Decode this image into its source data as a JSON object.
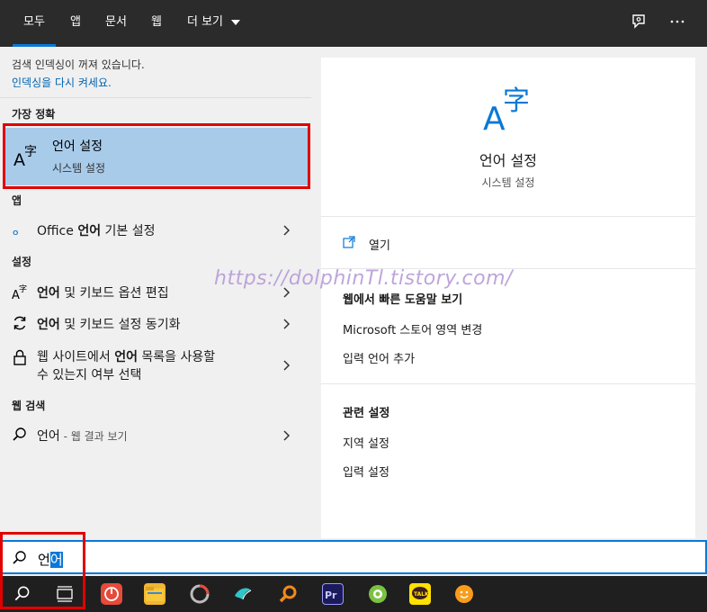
{
  "tabs": [
    {
      "label": "모두"
    },
    {
      "label": "앱"
    },
    {
      "label": "문서"
    },
    {
      "label": "웹"
    },
    {
      "label": "더 보기"
    }
  ],
  "index_notice": {
    "message": "검색 인덱싱이 꺼져 있습니다.",
    "link": "인덱싱을 다시 켜세요."
  },
  "best_match": {
    "section": "가장 정확",
    "title": "언어 설정",
    "subtitle": "시스템 설정"
  },
  "apps": {
    "section": "앱",
    "item_prefix": "Office ",
    "item_bold": "언어",
    "item_suffix": " 기본 설정"
  },
  "settings": {
    "section": "설정",
    "items": [
      {
        "bold": "언어",
        "rest": " 및 키보드 옵션 편집"
      },
      {
        "bold": "언어",
        "rest": " 및 키보드 설정 동기화"
      },
      {
        "prefix": "웹 사이트에서 ",
        "bold": "언어",
        "rest": " 목록을 사용할",
        "line2": "수 있는지 여부 선택"
      }
    ]
  },
  "web_search": {
    "section": "웹 검색",
    "query": "언어",
    "hint": " - 웹 결과 보기"
  },
  "detail": {
    "title": "언어 설정",
    "subtitle": "시스템 설정",
    "open_label": "열기",
    "help_heading": "웹에서 빠른 도움말 보기",
    "help_links": [
      "Microsoft 스토어 영역 변경",
      "입력 언어 추가"
    ],
    "related_heading": "관련 설정",
    "related_links": [
      "지역 설정",
      "입력 설정"
    ]
  },
  "watermark": "https://dolphinTl.tistory.com/",
  "search_box": {
    "value_prefix": "언",
    "value_selected": "어"
  },
  "colors": {
    "accent": "#0a78d7",
    "highlight": "#e00000",
    "selected_row": "#a8cbea"
  }
}
